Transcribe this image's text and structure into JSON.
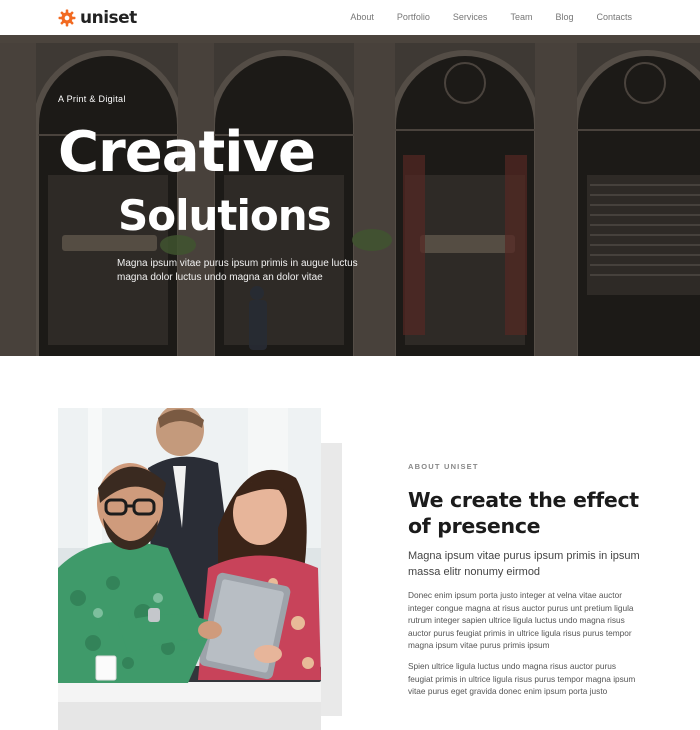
{
  "brand": {
    "name": "uniset",
    "accent": "#f26a21"
  },
  "nav": {
    "items": [
      "About",
      "Portfolio",
      "Services",
      "Team",
      "Blog",
      "Contacts"
    ]
  },
  "hero": {
    "kicker": "A Print & Digital",
    "title_line1": "Creative",
    "title_line2": "Solutions",
    "description": "Magna ipsum vitae purus ipsum primis in augue luctus magna dolor luctus undo magna an dolor vitae"
  },
  "about": {
    "label": "ABOUT UNISET",
    "title": "We create the effect of presence",
    "lead": "Magna ipsum vitae purus ipsum primis in ipsum massa elitr nonumy eirmod",
    "paragraph1": "Donec enim ipsum porta justo integer at velna vitae auctor integer congue magna at risus auctor purus unt pretium ligula rutrum integer sapien ultrice ligula luctus undo magna risus auctor purus feugiat primis in ultrice ligula risus purus tempor magna ipsum vitae purus primis ipsum",
    "paragraph2": "Spien ultrice ligula luctus undo magna risus auctor purus feugiat primis in ultrice ligula risus purus tempor magna ipsum vitae purus eget gravida donec enim ipsum porta justo"
  }
}
